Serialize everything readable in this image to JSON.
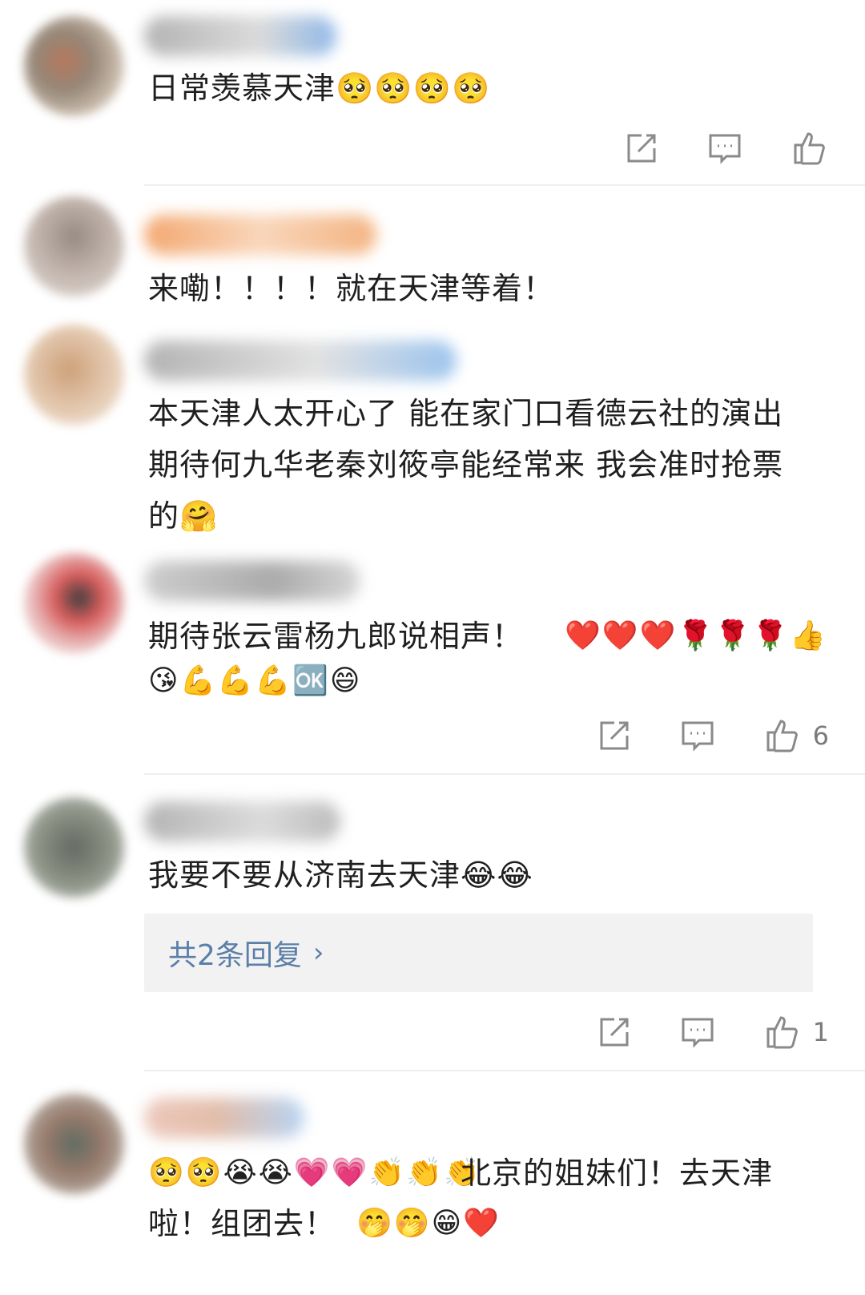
{
  "comments": [
    {
      "text": "日常羡慕天津",
      "emojis": "🥺🥺🥺🥺"
    },
    {
      "text": "来嘞！！！！就在天津等着！"
    },
    {
      "text": "本天津人太开心了 能在家门口看德云社的演出 期待何九华老秦刘筱亭能经常来 我会准时抢票的🤗"
    },
    {
      "text": "期待张云雷杨九郎说相声！",
      "emojis_line1": "❤️❤️❤️🌹🌹🌹👍",
      "emojis_line2": "😘💪💪💪🆗😄",
      "likes": "6"
    },
    {
      "text": "我要不要从济南去天津😂😂",
      "reply_label": "共2条回复",
      "likes": "1"
    },
    {
      "emojis": "🥺🥺😭😭💗💗👏👏👏",
      "text_line1": "北京的姐妹们！去天津",
      "text_line2": "啦！组团去！",
      "emojis_end": "🤭🤭😁❤️"
    }
  ],
  "icons": {
    "share": "share-icon",
    "comment": "comment-icon",
    "like": "like-icon"
  },
  "colors": {
    "reply_link": "#5b7fa8",
    "icon_gray": "#7a7a7a",
    "reply_bg": "#f2f2f2"
  }
}
